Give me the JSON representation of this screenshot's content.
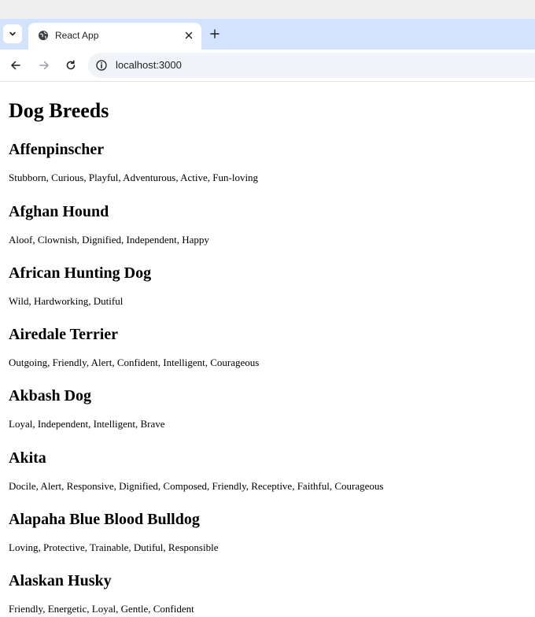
{
  "browser": {
    "tab_title": "React App",
    "url": "localhost:3000",
    "icons": {
      "tab_list": "chevron-down-icon",
      "favicon": "globe-icon",
      "close": "close-icon",
      "new_tab": "plus-icon",
      "back": "arrow-left-icon",
      "forward": "arrow-right-icon",
      "reload": "reload-icon",
      "site_info": "info-icon"
    },
    "colors": {
      "tab_strip": "#d3e3fd",
      "active_tab": "#ffffff",
      "omnibox": "#f0f3f7"
    }
  },
  "page": {
    "title": "Dog Breeds",
    "breeds": [
      {
        "name": "Affenpinscher",
        "temperament": "Stubborn, Curious, Playful, Adventurous, Active, Fun-loving"
      },
      {
        "name": "Afghan Hound",
        "temperament": "Aloof, Clownish, Dignified, Independent, Happy"
      },
      {
        "name": "African Hunting Dog",
        "temperament": "Wild, Hardworking, Dutiful"
      },
      {
        "name": "Airedale Terrier",
        "temperament": "Outgoing, Friendly, Alert, Confident, Intelligent, Courageous"
      },
      {
        "name": "Akbash Dog",
        "temperament": "Loyal, Independent, Intelligent, Brave"
      },
      {
        "name": "Akita",
        "temperament": "Docile, Alert, Responsive, Dignified, Composed, Friendly, Receptive, Faithful, Courageous"
      },
      {
        "name": "Alapaha Blue Blood Bulldog",
        "temperament": "Loving, Protective, Trainable, Dutiful, Responsible"
      },
      {
        "name": "Alaskan Husky",
        "temperament": "Friendly, Energetic, Loyal, Gentle, Confident"
      }
    ]
  }
}
